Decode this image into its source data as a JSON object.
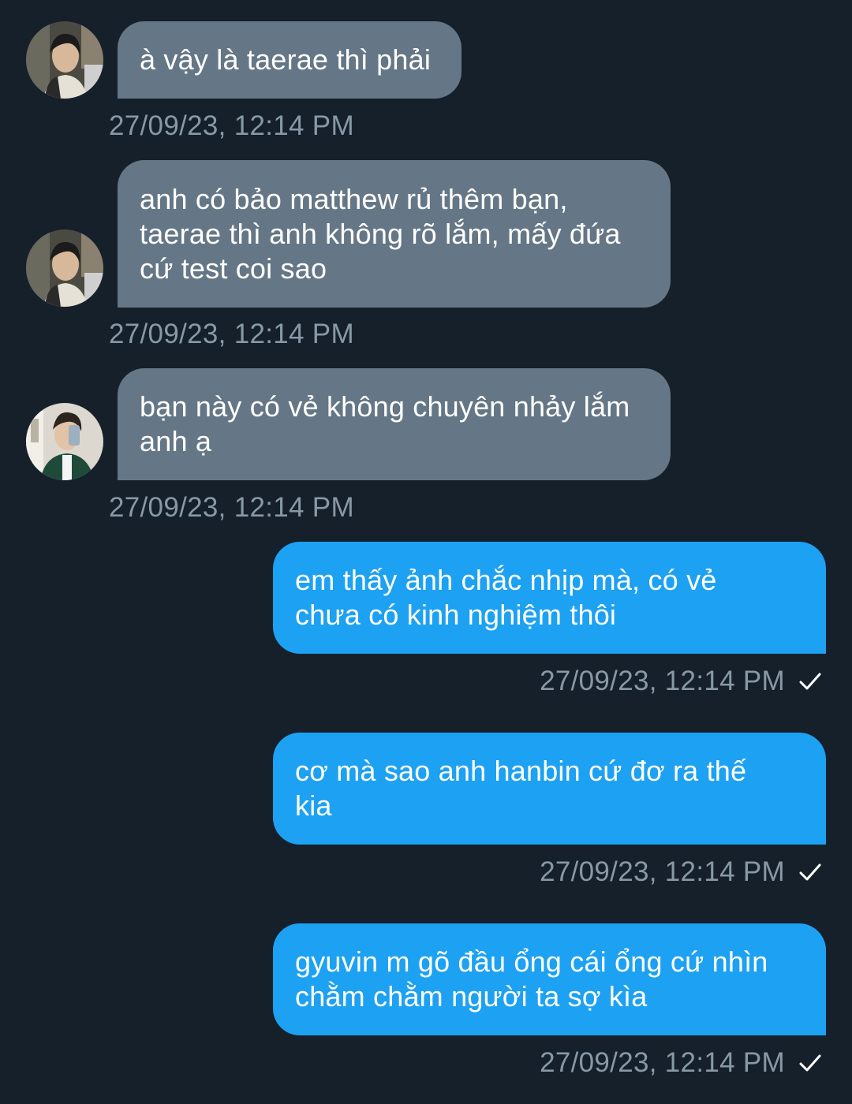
{
  "messages": [
    {
      "direction": "in",
      "avatar": "avatar-1",
      "lines": [
        "à vậy là taerae thì phải"
      ],
      "timestamp": "27/09/23, 12:14 PM"
    },
    {
      "direction": "in",
      "avatar": "avatar-1",
      "lines": [
        "anh có bảo matthew rủ thêm bạn,",
        "taerae thì anh không rõ lắm, mấy đứa",
        "cứ test coi sao"
      ],
      "timestamp": "27/09/23, 12:14 PM"
    },
    {
      "direction": "in",
      "avatar": "avatar-2",
      "lines": [
        "bạn này có vẻ không chuyên nhảy lắm",
        "anh ạ"
      ],
      "timestamp": "27/09/23, 12:14 PM"
    },
    {
      "direction": "out",
      "lines": [
        "em thấy ảnh chắc nhịp mà, có vẻ",
        "chưa có kinh nghiệm thôi"
      ],
      "timestamp": "27/09/23, 12:14 PM",
      "status_icon": "check-icon"
    },
    {
      "direction": "out",
      "lines": [
        "cơ mà sao anh hanbin cứ đơ ra thế",
        "kia"
      ],
      "timestamp": "27/09/23, 12:14 PM",
      "status_icon": "check-icon"
    },
    {
      "direction": "out",
      "lines": [
        "gyuvin m gõ đầu ổng cái ổng cứ nhìn",
        "chằm chằm người ta sợ kìa"
      ],
      "timestamp": "27/09/23, 12:14 PM",
      "status_icon": "check-icon"
    }
  ],
  "colors": {
    "background": "#15202b",
    "incoming_bubble": "#657786",
    "outgoing_bubble": "#1da1f2",
    "timestamp": "#8899a6",
    "text": "#ffffff"
  }
}
